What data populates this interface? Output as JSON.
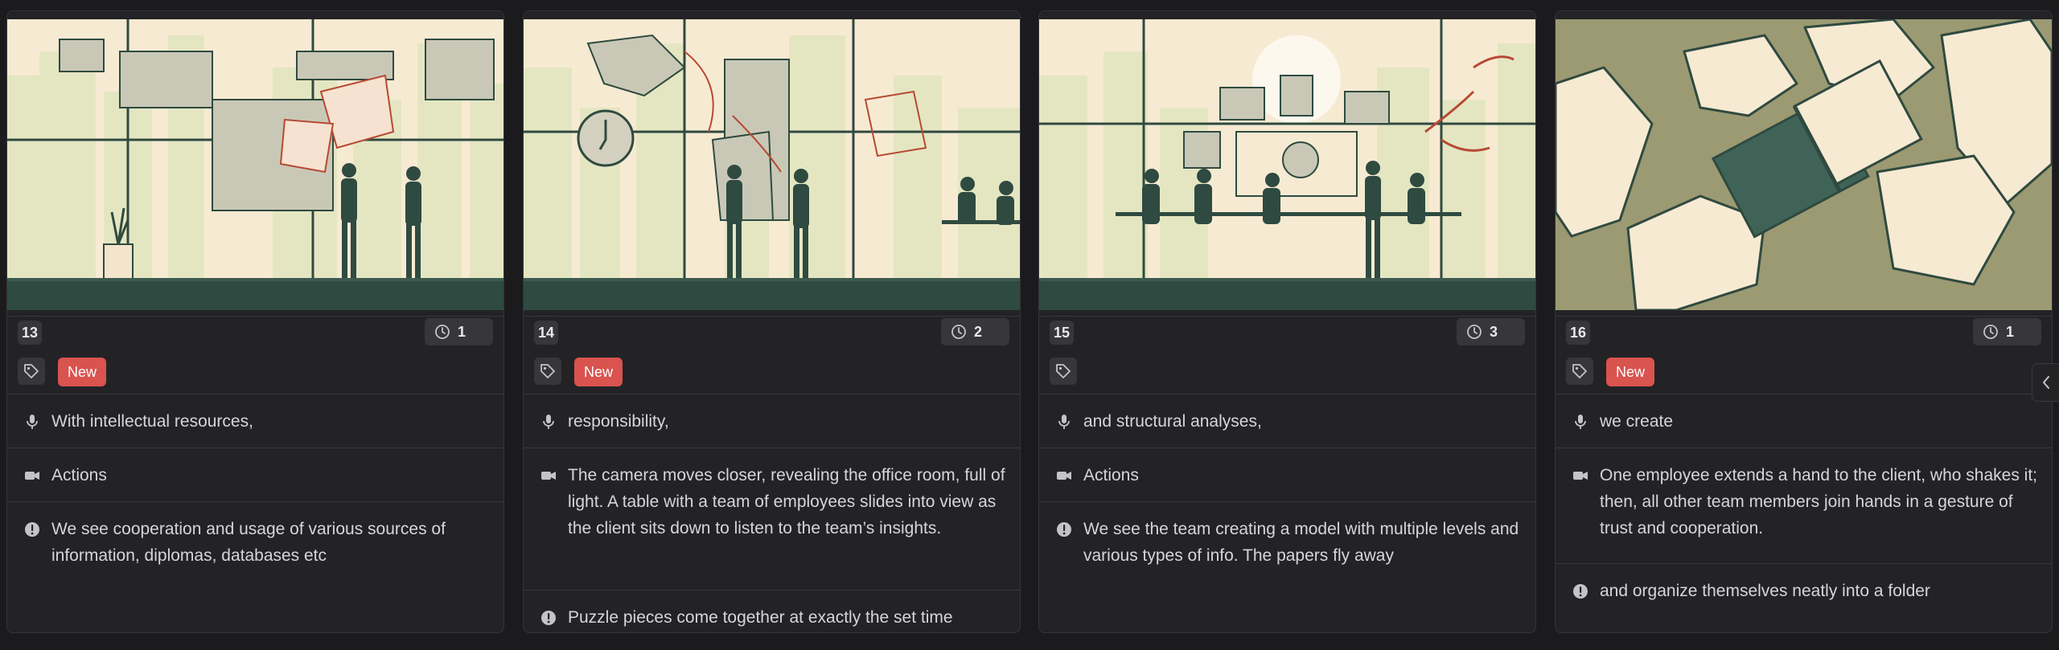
{
  "accent_new": "#d9534f",
  "panel_toggle_icon": "chevron-left-icon",
  "cards": [
    {
      "number": "13",
      "duration": "1",
      "tag": "New",
      "voiceover": "With intellectual resources,",
      "camera": "Actions",
      "notes": [
        "We see cooperation and usage of various sources of information, diplomas, databases etc"
      ]
    },
    {
      "number": "14",
      "duration": "2",
      "tag": "New",
      "voiceover": "responsibility,",
      "camera": "The camera moves closer, revealing the office room, full of light. A table with a team of employees slides into view as the client sits down to listen to the team’s insights.",
      "notes": [
        "Puzzle pieces come together at exactly the set time"
      ]
    },
    {
      "number": "15",
      "duration": "3",
      "tag": "",
      "voiceover": "and structural analyses,",
      "camera": "Actions",
      "notes": [
        "We see the team creating a model with multiple levels and various types of info. The papers fly away"
      ]
    },
    {
      "number": "16",
      "duration": "1",
      "tag": "New",
      "voiceover": "we create",
      "camera": "One employee extends a hand to the client, who shakes it; then, all other team members join hands in a gesture of trust and cooperation.",
      "notes": [
        "and organize themselves neatly into a folder"
      ]
    }
  ]
}
